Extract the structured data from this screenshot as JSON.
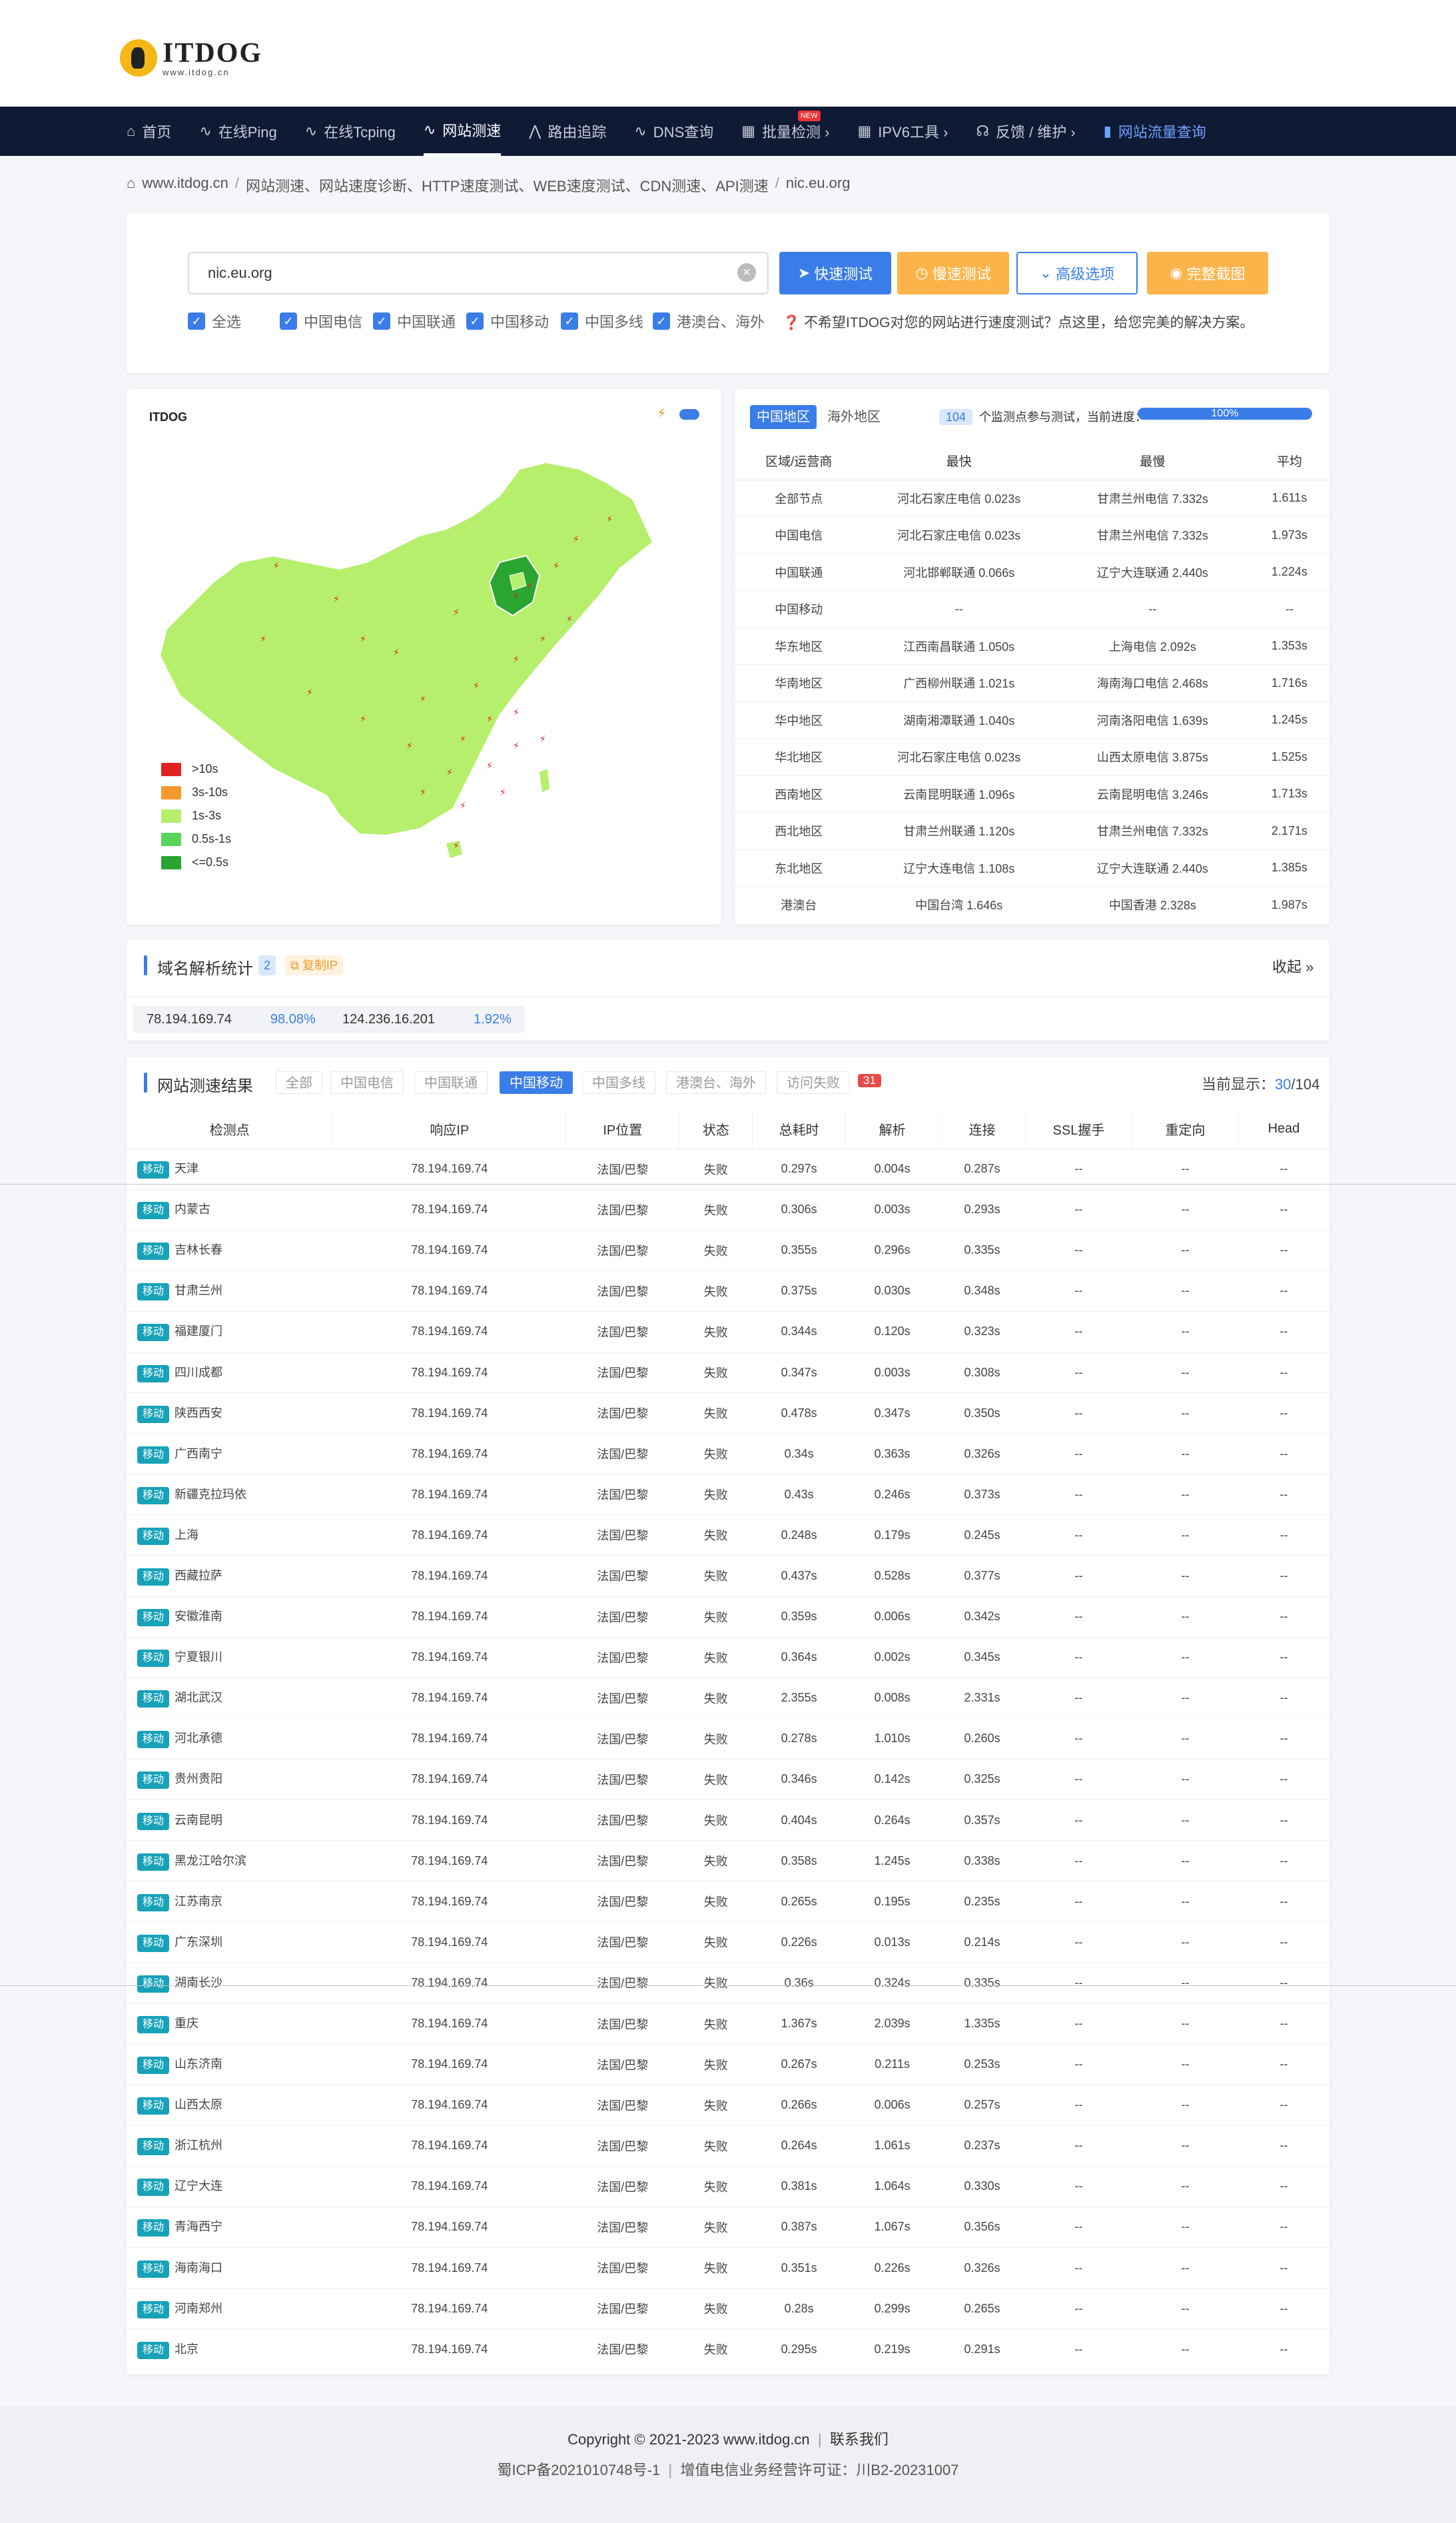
{
  "brand": {
    "name": "ITDOG",
    "site": "www.itdog.cn"
  },
  "nav": [
    {
      "icon": "⌂",
      "label": "首页",
      "active": false
    },
    {
      "icon": "∿",
      "label": "在线Ping",
      "active": false
    },
    {
      "icon": "∿",
      "label": "在线Tcping",
      "active": false
    },
    {
      "icon": "∿",
      "label": "网站测速",
      "active": true
    },
    {
      "icon": "⋀",
      "label": "路由追踪",
      "active": false
    },
    {
      "icon": "∿",
      "label": "DNS查询",
      "active": false
    },
    {
      "icon": "▦",
      "label": "批量检测 ›",
      "active": false,
      "badge": "NEW"
    },
    {
      "icon": "▦",
      "label": "IPV6工具 ›",
      "active": false
    },
    {
      "icon": "☊",
      "label": "反馈 / 维护 ›",
      "active": false
    },
    {
      "icon": "▮",
      "label": "网站流量查询",
      "active": false,
      "blue": true
    }
  ],
  "breadcrumb": [
    "www.itdog.cn",
    "网站测速、网站速度诊断、HTTP速度测试、WEB速度测试、CDN测速、API测速",
    "nic.eu.org"
  ],
  "search": {
    "value": "nic.eu.org",
    "btn_fast": "快速测试",
    "btn_slow": "慢速测试",
    "btn_adv": "高级选项",
    "btn_shot": "完整截图",
    "checks": [
      "全选",
      "中国电信",
      "中国联通",
      "中国移动",
      "中国多线",
      "港澳台、海外"
    ],
    "tip": "不希望ITDOG对您的网站进行速度测试？点这里，给您完美的解决方案。"
  },
  "map": {
    "legend": [
      {
        "label": ">10s",
        "color": "#e02424"
      },
      {
        "label": "3s-10s",
        "color": "#f29a2e"
      },
      {
        "label": "1s-3s",
        "color": "#b6ef6c"
      },
      {
        "label": "0.5s-1s",
        "color": "#59d65a"
      },
      {
        "label": "<=0.5s",
        "color": "#2aa532"
      }
    ]
  },
  "stats": {
    "tab_cn": "中国地区",
    "tab_os": "海外地区",
    "count": "104",
    "count_text": "个监测点参与测试，当前进度：",
    "progress": "100%",
    "headers": [
      "区域/运营商",
      "最快",
      "最慢",
      "平均"
    ],
    "rows": [
      [
        "全部节点",
        "河北石家庄电信 0.023s",
        "甘肃兰州电信 7.332s",
        "1.611s"
      ],
      [
        "中国电信",
        "河北石家庄电信 0.023s",
        "甘肃兰州电信 7.332s",
        "1.973s"
      ],
      [
        "中国联通",
        "河北邯郸联通 0.066s",
        "辽宁大连联通 2.440s",
        "1.224s"
      ],
      [
        "中国移动",
        "--",
        "--",
        "--"
      ],
      [
        "华东地区",
        "江西南昌联通 1.050s",
        "上海电信 2.092s",
        "1.353s"
      ],
      [
        "华南地区",
        "广西柳州联通 1.021s",
        "海南海口电信 2.468s",
        "1.716s"
      ],
      [
        "华中地区",
        "湖南湘潭联通 1.040s",
        "河南洛阳电信 1.639s",
        "1.245s"
      ],
      [
        "华北地区",
        "河北石家庄电信 0.023s",
        "山西太原电信 3.875s",
        "1.525s"
      ],
      [
        "西南地区",
        "云南昆明联通 1.096s",
        "云南昆明电信 3.246s",
        "1.713s"
      ],
      [
        "西北地区",
        "甘肃兰州联通 1.120s",
        "甘肃兰州电信 7.332s",
        "2.171s"
      ],
      [
        "东北地区",
        "辽宁大连电信 1.108s",
        "辽宁大连联通 2.440s",
        "1.385s"
      ],
      [
        "港澳台",
        "中国台湾 1.646s",
        "中国香港 2.328s",
        "1.987s"
      ]
    ]
  },
  "dns": {
    "title": "域名解析统计",
    "count": "2",
    "copy": "复制IP",
    "collapse": "收起 »",
    "ips": [
      {
        "ip": "78.194.169.74",
        "pct": "98.08%"
      },
      {
        "ip": "124.236.16.201",
        "pct": "1.92%"
      }
    ]
  },
  "results": {
    "title": "网站测速结果",
    "tabs": [
      "全部",
      "中国电信",
      "中国联通",
      "中国移动",
      "中国多线",
      "港澳台、海外",
      "访问失败"
    ],
    "fail_count": "31",
    "showing_label": "当前显示：",
    "showing_cur": "30",
    "showing_total": "/104",
    "headers": [
      "检测点",
      "响应IP",
      "IP位置",
      "状态",
      "总耗时",
      "解析",
      "连接",
      "SSL握手",
      "重定向",
      "Head"
    ],
    "isp": "移动",
    "ip": "78.194.169.74",
    "loc": "法国/巴黎",
    "status": "失败",
    "dash": "--",
    "rows": [
      [
        "天津",
        "0.297s",
        "0.004s",
        "0.287s"
      ],
      [
        "内蒙古",
        "0.306s",
        "0.003s",
        "0.293s"
      ],
      [
        "吉林长春",
        "0.355s",
        "0.296s",
        "0.335s"
      ],
      [
        "甘肃兰州",
        "0.375s",
        "0.030s",
        "0.348s"
      ],
      [
        "福建厦门",
        "0.344s",
        "0.120s",
        "0.323s"
      ],
      [
        "四川成都",
        "0.347s",
        "0.003s",
        "0.308s"
      ],
      [
        "陕西西安",
        "0.478s",
        "0.347s",
        "0.350s"
      ],
      [
        "广西南宁",
        "0.34s",
        "0.363s",
        "0.326s"
      ],
      [
        "新疆克拉玛依",
        "0.43s",
        "0.246s",
        "0.373s"
      ],
      [
        "上海",
        "0.248s",
        "0.179s",
        "0.245s"
      ],
      [
        "西藏拉萨",
        "0.437s",
        "0.528s",
        "0.377s"
      ],
      [
        "安徽淮南",
        "0.359s",
        "0.006s",
        "0.342s"
      ],
      [
        "宁夏银川",
        "0.364s",
        "0.002s",
        "0.345s"
      ],
      [
        "湖北武汉",
        "2.355s",
        "0.008s",
        "2.331s"
      ],
      [
        "河北承德",
        "0.278s",
        "1.010s",
        "0.260s"
      ],
      [
        "贵州贵阳",
        "0.346s",
        "0.142s",
        "0.325s"
      ],
      [
        "云南昆明",
        "0.404s",
        "0.264s",
        "0.357s"
      ],
      [
        "黑龙江哈尔滨",
        "0.358s",
        "1.245s",
        "0.338s"
      ],
      [
        "江苏南京",
        "0.265s",
        "0.195s",
        "0.235s"
      ],
      [
        "广东深圳",
        "0.226s",
        "0.013s",
        "0.214s"
      ],
      [
        "湖南长沙",
        "0.36s",
        "0.324s",
        "0.335s"
      ],
      [
        "重庆",
        "1.367s",
        "2.039s",
        "1.335s"
      ],
      [
        "山东济南",
        "0.267s",
        "0.211s",
        "0.253s"
      ],
      [
        "山西太原",
        "0.266s",
        "0.006s",
        "0.257s"
      ],
      [
        "浙江杭州",
        "0.264s",
        "1.061s",
        "0.237s"
      ],
      [
        "辽宁大连",
        "0.381s",
        "1.064s",
        "0.330s"
      ],
      [
        "青海西宁",
        "0.387s",
        "1.067s",
        "0.356s"
      ],
      [
        "海南海口",
        "0.351s",
        "0.226s",
        "0.326s"
      ],
      [
        "河南郑州",
        "0.28s",
        "0.299s",
        "0.265s"
      ],
      [
        "北京",
        "0.295s",
        "0.219s",
        "0.291s"
      ]
    ]
  },
  "footer": {
    "copyright": "Copyright © 2021-2023 www.itdog.cn",
    "contact": "联系我们",
    "icp": "蜀ICP备2021010748号-1",
    "license": "增值电信业务经营许可证：川B2-20231007"
  }
}
